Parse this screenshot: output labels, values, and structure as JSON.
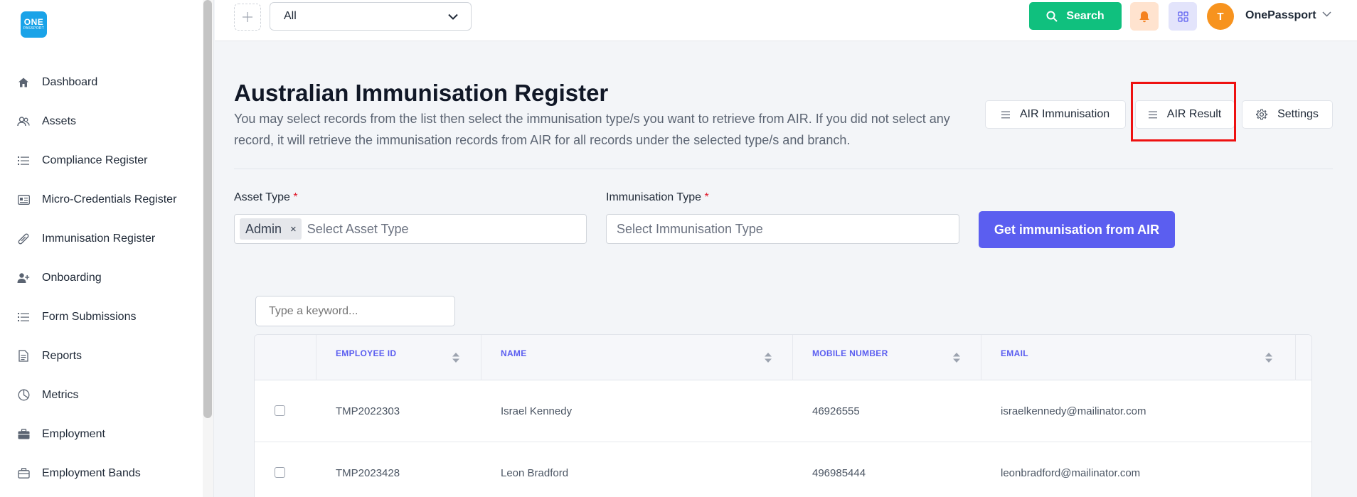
{
  "logo": {
    "line1": "ONE",
    "line2": "PASSPORT"
  },
  "sidebar": {
    "items": [
      {
        "label": "Dashboard",
        "icon": "home-icon"
      },
      {
        "label": "Assets",
        "icon": "users-icon"
      },
      {
        "label": "Compliance Register",
        "icon": "list-icon"
      },
      {
        "label": "Micro-Credentials Register",
        "icon": "id-card-icon"
      },
      {
        "label": "Immunisation Register",
        "icon": "pill-icon"
      },
      {
        "label": "Onboarding",
        "icon": "user-plus-icon"
      },
      {
        "label": "Form Submissions",
        "icon": "list-icon"
      },
      {
        "label": "Reports",
        "icon": "document-icon"
      },
      {
        "label": "Metrics",
        "icon": "pie-chart-icon"
      },
      {
        "label": "Employment",
        "icon": "briefcase-icon"
      },
      {
        "label": "Employment Bands",
        "icon": "briefcase-outline-icon"
      }
    ]
  },
  "topbar": {
    "filter_value": "All",
    "search_label": "Search",
    "user_initial": "T",
    "user_name": "OnePassport"
  },
  "header": {
    "title": "Australian Immunisation Register",
    "description": "You may select records from the list then select the immunisation type/s you want to retrieve from AIR. If you did not select any record, it will retrieve the immunisation records from AIR for all records under the selected type/s and branch.",
    "buttons": {
      "air_immunisation": "AIR Immunisation",
      "air_result": "AIR Result",
      "settings": "Settings"
    }
  },
  "filters": {
    "asset_type_label": "Asset Type",
    "asset_type_tag": "Admin",
    "asset_type_tag_remove": "×",
    "asset_type_placeholder": "Select Asset Type",
    "immunisation_type_label": "Immunisation Type",
    "immunisation_type_placeholder": "Select Immunisation Type",
    "required_mark": "*",
    "get_button": "Get immunisation from AIR"
  },
  "table": {
    "keyword_placeholder": "Type a keyword...",
    "columns": [
      "EMPLOYEE ID",
      "NAME",
      "MOBILE NUMBER",
      "EMAIL"
    ],
    "rows": [
      {
        "employee_id": "TMP2022303",
        "name": "Israel Kennedy",
        "mobile": "46926555",
        "email": "israelkennedy@mailinator.com"
      },
      {
        "employee_id": "TMP2023428",
        "name": "Leon Bradford",
        "mobile": "496985444",
        "email": "leonbradford@mailinator.com"
      }
    ]
  },
  "colors": {
    "accent": "#5b5ef0",
    "search_green": "#10c07e",
    "avatar_orange": "#f7931e",
    "highlight_red": "#ee1111"
  }
}
